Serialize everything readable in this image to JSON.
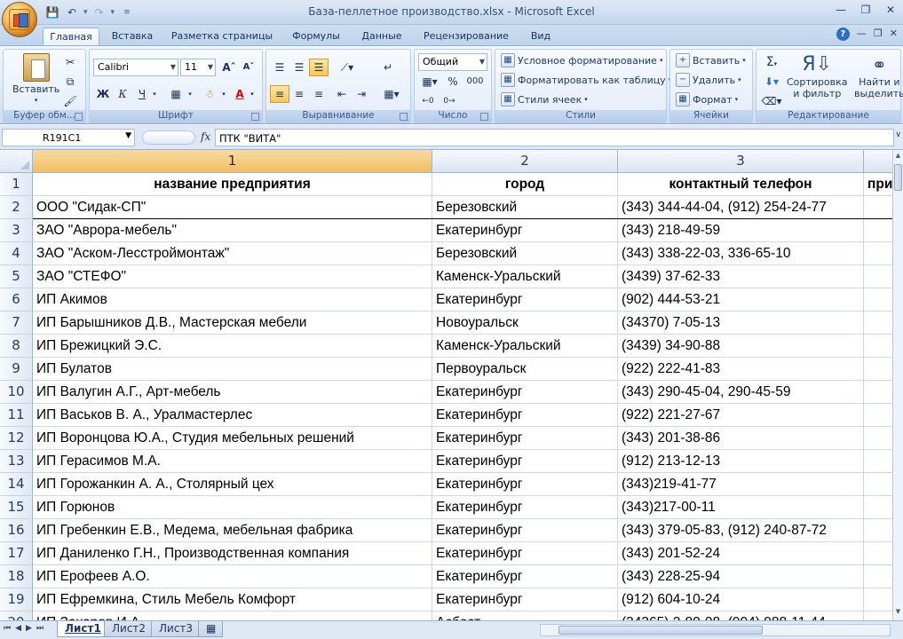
{
  "window": {
    "title": "База-пеллетное производство.xlsx - Microsoft Excel"
  },
  "ribbon_tabs": [
    "Главная",
    "Вставка",
    "Разметка страницы",
    "Формулы",
    "Данные",
    "Рецензирование",
    "Вид"
  ],
  "ribbon": {
    "clipboard": {
      "paste": "Вставить",
      "label": "Буфер обм..."
    },
    "font": {
      "name": "Calibri",
      "size": "11",
      "bold": "Ж",
      "italic": "К",
      "underline": "Ч",
      "label": "Шрифт"
    },
    "alignment": {
      "label": "Выравнивание"
    },
    "number": {
      "format": "Общий",
      "percent": "%",
      "thousands": "000",
      "label": "Число"
    },
    "styles": {
      "conditional": "Условное форматирование",
      "as_table": "Форматировать как таблицу",
      "cell_styles": "Стили ячеек",
      "label": "Стили"
    },
    "cells": {
      "insert": "Вставить",
      "delete": "Удалить",
      "format": "Формат",
      "label": "Ячейки"
    },
    "editing": {
      "sum": "Σ",
      "sort_line1": "Сортировка",
      "sort_line2": "и фильтр",
      "find_line1": "Найти и",
      "find_line2": "выделить",
      "label": "Редактирование"
    }
  },
  "formula_bar": {
    "name_box": "R191C1",
    "fx": "fx",
    "content": "ПТК \"ВИТА\""
  },
  "grid": {
    "columns": [
      "1",
      "2",
      "3",
      ""
    ],
    "rows": [
      {
        "n": "1",
        "cells": [
          "название предприятия",
          "город",
          "контактный телефон",
          "при"
        ]
      },
      {
        "n": "2",
        "cells": [
          "ООО \"Сидак-СП\"",
          "Березовский",
          "(343) 344-44-04, (912) 254-24-77",
          ""
        ]
      },
      {
        "n": "3",
        "cells": [
          "ЗАО \"Аврора-мебель\"",
          "Екатеринбург",
          "(343) 218-49-59",
          ""
        ]
      },
      {
        "n": "4",
        "cells": [
          "ЗАО \"Аском-Лесстроймонтаж\"",
          "Березовский",
          "(343) 338-22-03, 336-65-10",
          ""
        ]
      },
      {
        "n": "5",
        "cells": [
          "ЗАО \"СТЕФО\"",
          "Каменск-Уральский",
          "(3439) 37-62-33",
          ""
        ]
      },
      {
        "n": "6",
        "cells": [
          "ИП Акимов",
          "Екатеринбург",
          "(902) 444-53-21",
          ""
        ]
      },
      {
        "n": "7",
        "cells": [
          "ИП Барышников Д.В., Мастерская мебели",
          "Новоуральск",
          "(34370) 7-05-13",
          ""
        ]
      },
      {
        "n": "8",
        "cells": [
          "ИП Брежицкий Э.С.",
          "Каменск-Уральский",
          "(3439) 34-90-88",
          ""
        ]
      },
      {
        "n": "9",
        "cells": [
          "ИП Булатов",
          "Первоуральск",
          "(922) 222-41-83",
          ""
        ]
      },
      {
        "n": "10",
        "cells": [
          "ИП Валугин А.Г., Арт-мебель",
          "Екатеринбург",
          "(343) 290-45-04, 290-45-59",
          ""
        ]
      },
      {
        "n": "11",
        "cells": [
          "ИП Васьков В. А., Уралмастерлес",
          "Екатеринбург",
          "(922) 221-27-67",
          ""
        ]
      },
      {
        "n": "12",
        "cells": [
          "ИП Воронцова Ю.А., Студия мебельных решений",
          "Екатеринбург",
          "(343) 201-38-86",
          ""
        ]
      },
      {
        "n": "13",
        "cells": [
          "ИП Герасимов М.А.",
          "Екатеринбург",
          "(912) 213-12-13",
          ""
        ]
      },
      {
        "n": "14",
        "cells": [
          "ИП Горожанкин А. А., Столярный цех",
          "Екатеринбург",
          "(343)219-41-77",
          ""
        ]
      },
      {
        "n": "15",
        "cells": [
          "ИП Горюнов",
          "Екатеринбург",
          "(343)217-00-11",
          ""
        ]
      },
      {
        "n": "16",
        "cells": [
          "ИП Гребенкин Е.В., Медема, мебельная фабрика",
          "Екатеринбург",
          "(343) 379-05-83, (912) 240-87-72",
          ""
        ]
      },
      {
        "n": "17",
        "cells": [
          "ИП Даниленко Г.Н., Производственная компания",
          "Екатеринбург",
          "(343) 201-52-24",
          ""
        ]
      },
      {
        "n": "18",
        "cells": [
          "ИП Ерофеев А.О.",
          "Екатеринбург",
          "(343) 228-25-94",
          ""
        ]
      },
      {
        "n": "19",
        "cells": [
          "ИП Ефремкина, Стиль Мебель Комфорт",
          "Екатеринбург",
          "(912) 604-10-24",
          ""
        ]
      },
      {
        "n": "20",
        "cells": [
          "ИП Захаров И.А.",
          "Асбест",
          "(34365) 2-80-08, (904) 988-11-44",
          ""
        ]
      }
    ]
  },
  "sheet_tabs": [
    "Лист1",
    "Лист2",
    "Лист3"
  ]
}
